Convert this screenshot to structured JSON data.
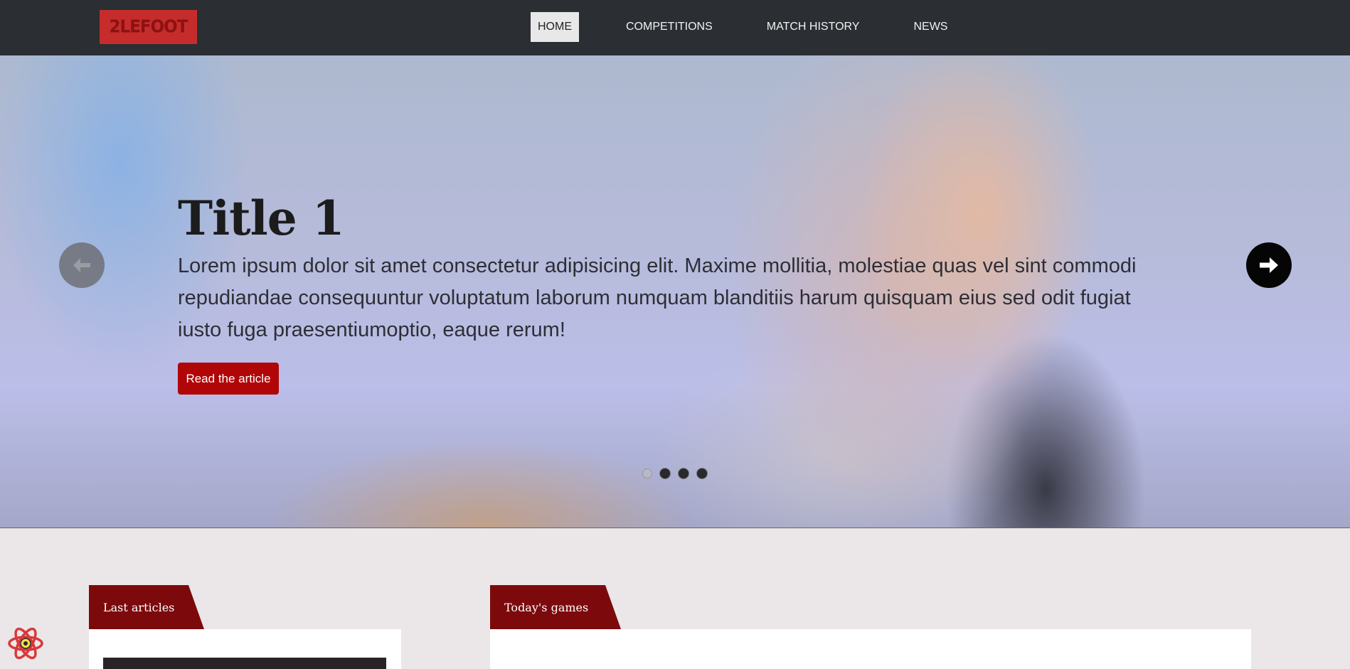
{
  "brand": {
    "logo_text": "2LEFOOT"
  },
  "nav": {
    "items": [
      {
        "label": "HOME",
        "active": true
      },
      {
        "label": "COMPETITIONS",
        "active": false
      },
      {
        "label": "MATCH HISTORY",
        "active": false
      },
      {
        "label": "NEWS",
        "active": false
      }
    ]
  },
  "carousel": {
    "title": "Title 1",
    "text": "Lorem ipsum dolor sit amet consectetur adipisicing elit. Maxime mollitia, molestiae quas vel sint commodi repudiandae consequuntur voluptatum laborum numquam blanditiis harum quisquam eius sed odit fugiat iusto fuga praesentiumoptio, eaque rerum!",
    "button_label": "Read the article",
    "slide_count": 4,
    "active_slide": 1,
    "prev_icon": "arrow-left-icon",
    "next_icon": "arrow-right-icon"
  },
  "sections": {
    "articles_title": "Last articles",
    "games_title": "Today's games"
  },
  "colors": {
    "navbar_bg": "#2b2e33",
    "accent_red": "#b10608",
    "tab_red": "#7c0a0c",
    "logo_red": "#c62c2c"
  },
  "dev_tool_icon": "react-devtools-icon"
}
